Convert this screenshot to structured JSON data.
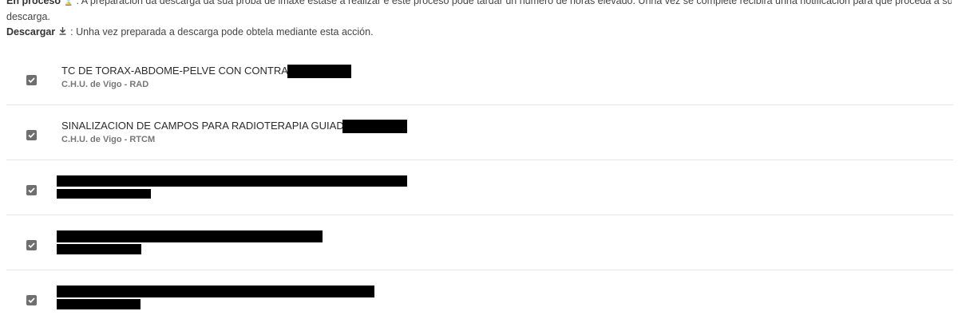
{
  "info": {
    "line1_label": "En proceso",
    "line1_text": ": A preparación da descarga da súa proba de imaxe estase a realizar e este proceso pode tardar un número de horas elevado. Unha vez se complete recibirá unha notificación para que proceda á súa",
    "line2_text": "descarga.",
    "line3_label": "Descargar",
    "line3_icon": "download-icon",
    "line3_text": ": Unha vez preparada a descarga pode obtela mediante esta acción."
  },
  "studies": [
    {
      "checked": true,
      "title": "TC DE TORAX-ABDOME-PELVE CON CONTRASTE",
      "center": "C.H.U. de Vigo - RAD"
    },
    {
      "checked": true,
      "title": "SINALIZACION DE CAMPOS PARA RADIOTERAPIA GUIADA TC",
      "center": "C.H.U. de Vigo - RTCM"
    },
    {
      "checked": true,
      "title": "",
      "center": ""
    },
    {
      "checked": true,
      "title": "",
      "center": ""
    },
    {
      "checked": true,
      "title": "",
      "center": ""
    }
  ],
  "colors": {
    "checkbox": "#6f6f6f",
    "redaction": "#000000",
    "divider": "#e6e6e6"
  }
}
